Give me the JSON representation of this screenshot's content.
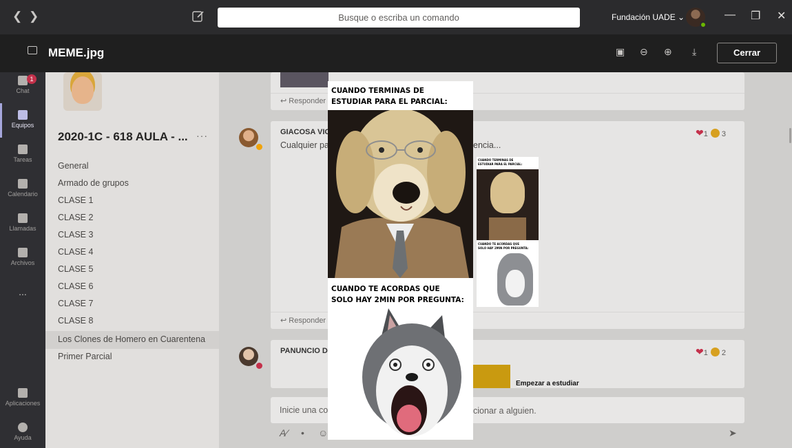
{
  "titlebar": {
    "search_placeholder": "Busque o escriba un comando",
    "org_label": "Fundación UADE ⌄"
  },
  "viewer": {
    "file_name": "MEME.jpg",
    "close_label": "Cerrar"
  },
  "rail": {
    "badge": "1",
    "items": [
      {
        "label": "Chat",
        "icon": "chat-icon"
      },
      {
        "label": "Equipos",
        "icon": "teams-icon"
      },
      {
        "label": "Tareas",
        "icon": "assignments-icon"
      },
      {
        "label": "Calendario",
        "icon": "calendar-icon"
      },
      {
        "label": "Llamadas",
        "icon": "calls-icon"
      },
      {
        "label": "Archivos",
        "icon": "files-icon"
      },
      {
        "label": "...",
        "icon": "more-icon"
      },
      {
        "label": "Aplicaciones",
        "icon": "apps-icon"
      },
      {
        "label": "Ayuda",
        "icon": "help-icon"
      }
    ]
  },
  "team": {
    "name": "2020-1C - 618 AULA - ...",
    "more": "···",
    "channels": [
      "General",
      "Armado de grupos",
      "CLASE 1",
      "CLASE 2",
      "CLASE 3",
      "CLASE 4",
      "CLASE 5",
      "CLASE 6",
      "CLASE 7",
      "CLASE 8",
      "Los Clones de Homero en Cuarentena",
      "Primer Parcial"
    ],
    "selected_channel": "Los Clones de Homero en Cuarentena"
  },
  "posts": [
    {
      "reply_label": "Responder"
    },
    {
      "author": "GIACOSA VIC",
      "text_start": "Cualquier pa",
      "text_end": "encia...",
      "heart_count": "1",
      "laugh_count": "3",
      "reply_label": "Responder"
    },
    {
      "author": "PANUNCIO DI",
      "heart_count": "1",
      "laugh_count": "2",
      "snippet": "Empezar a estudiar"
    }
  ],
  "composer": {
    "placeholder_start": "Inicie una co",
    "placeholder_end": "cionar a alguien."
  },
  "meme": {
    "caption_top_1": "CUANDO TERMINAS DE",
    "caption_top_2": "ESTUDIAR PARA EL PARCIAL:",
    "caption_bottom_1": "CUANDO TE ACORDAS QUE",
    "caption_bottom_2": "SOLO HAY 2MIN POR PREGUNTA:"
  },
  "mini_meme": {
    "cap1": "CUANDO TERMINAS DE",
    "cap2": "ESTUDIAR PARA EL PARCIAL:",
    "cap3": "CUANDO TE ACORDAS QUE",
    "cap4": "SOLO HAY 2MIN POR PREGUNTA:"
  }
}
